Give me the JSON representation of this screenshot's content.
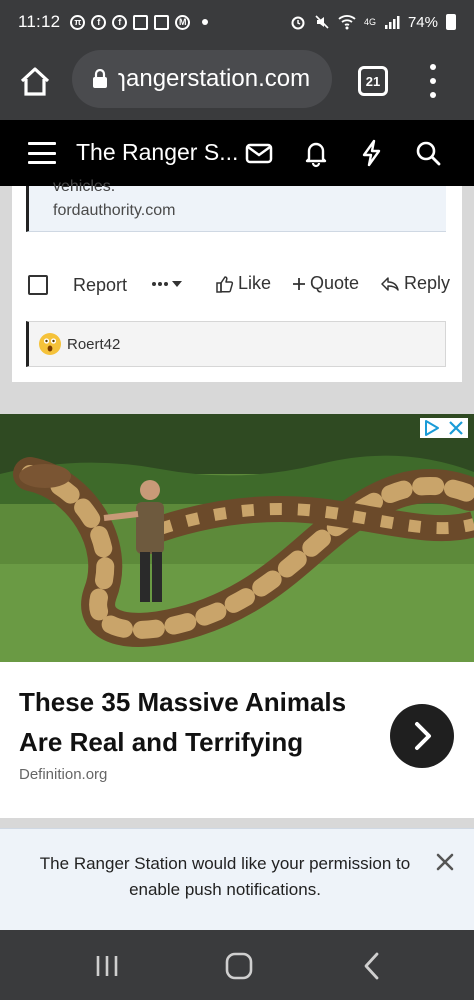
{
  "status_bar": {
    "time": "11:12",
    "network": "4G",
    "battery": "74%"
  },
  "browser": {
    "url": "ɿangerstation.com",
    "tab_count": "21"
  },
  "site_header": {
    "title": "The Ranger S..."
  },
  "post": {
    "quote_cut_text": "vehicles.",
    "quote_link": "fordauthority.com",
    "actions": {
      "report": "Report",
      "like": "Like",
      "quote": "Quote",
      "reply": "Reply"
    },
    "reaction_user": "Roert42"
  },
  "ad": {
    "headline": "These 35 Massive Animals Are Real and Terrifying",
    "source": "Definition.org"
  },
  "push_prompt": {
    "text": "The Ranger Station would like your permission to enable push notifications."
  },
  "colors": {
    "system_bar": "#3a3b3d",
    "site_header": "#000000",
    "quote_bg": "#eef3f9"
  }
}
